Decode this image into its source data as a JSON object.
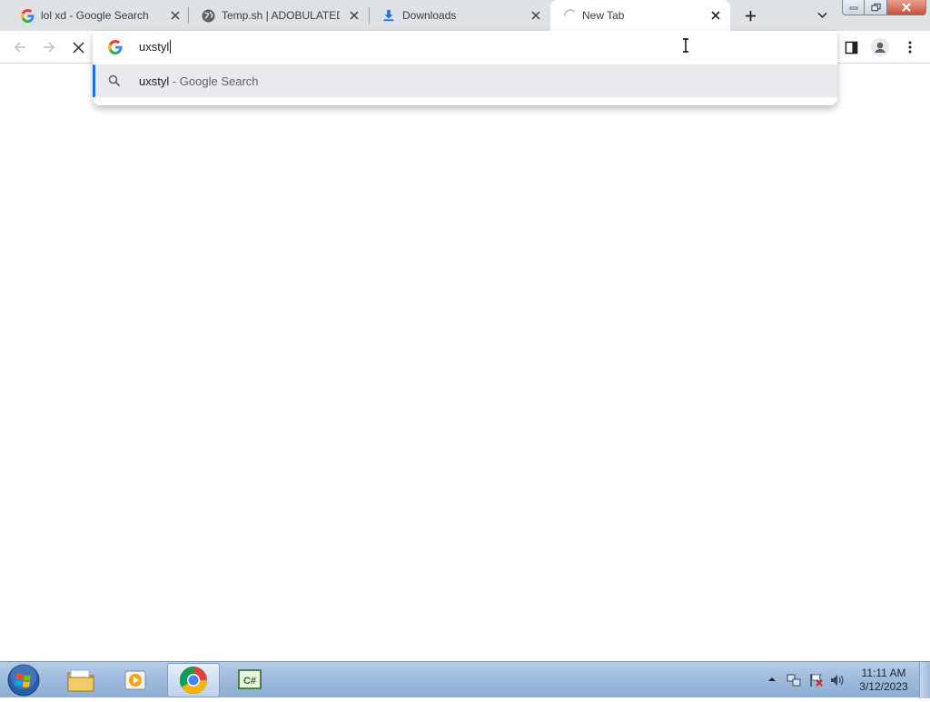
{
  "browser": {
    "tabs": [
      {
        "title": "lol xd - Google Search",
        "icon": "google-g-icon",
        "active": false
      },
      {
        "title": "Temp.sh | ADOBULATED.",
        "icon": "globe-icon",
        "active": false
      },
      {
        "title": "Downloads",
        "icon": "download-icon",
        "active": false
      },
      {
        "title": "New Tab",
        "icon": "loading-spinner-icon",
        "active": true
      }
    ],
    "omnibox": {
      "value": "uxstyl",
      "suggestions": [
        {
          "text": "uxstyl",
          "suffix": " - Google Search",
          "icon": "search-icon"
        }
      ]
    }
  },
  "taskbar": {
    "apps": [
      {
        "name": "Windows Explorer",
        "icon": "folder-icon"
      },
      {
        "name": "Windows Media Player",
        "icon": "media-player-icon"
      },
      {
        "name": "Google Chrome",
        "icon": "chrome-icon",
        "active": true
      },
      {
        "name": "C# Editor",
        "icon": "csharp-icon"
      }
    ],
    "clock": {
      "time": "11:11 AM",
      "date": "3/12/2023"
    }
  },
  "colors": {
    "tabstrip_bg": "#dee1e6",
    "accent": "#1a73e8",
    "suggestion_bg": "#e8eaed",
    "taskbar": "#9fbbdc"
  }
}
